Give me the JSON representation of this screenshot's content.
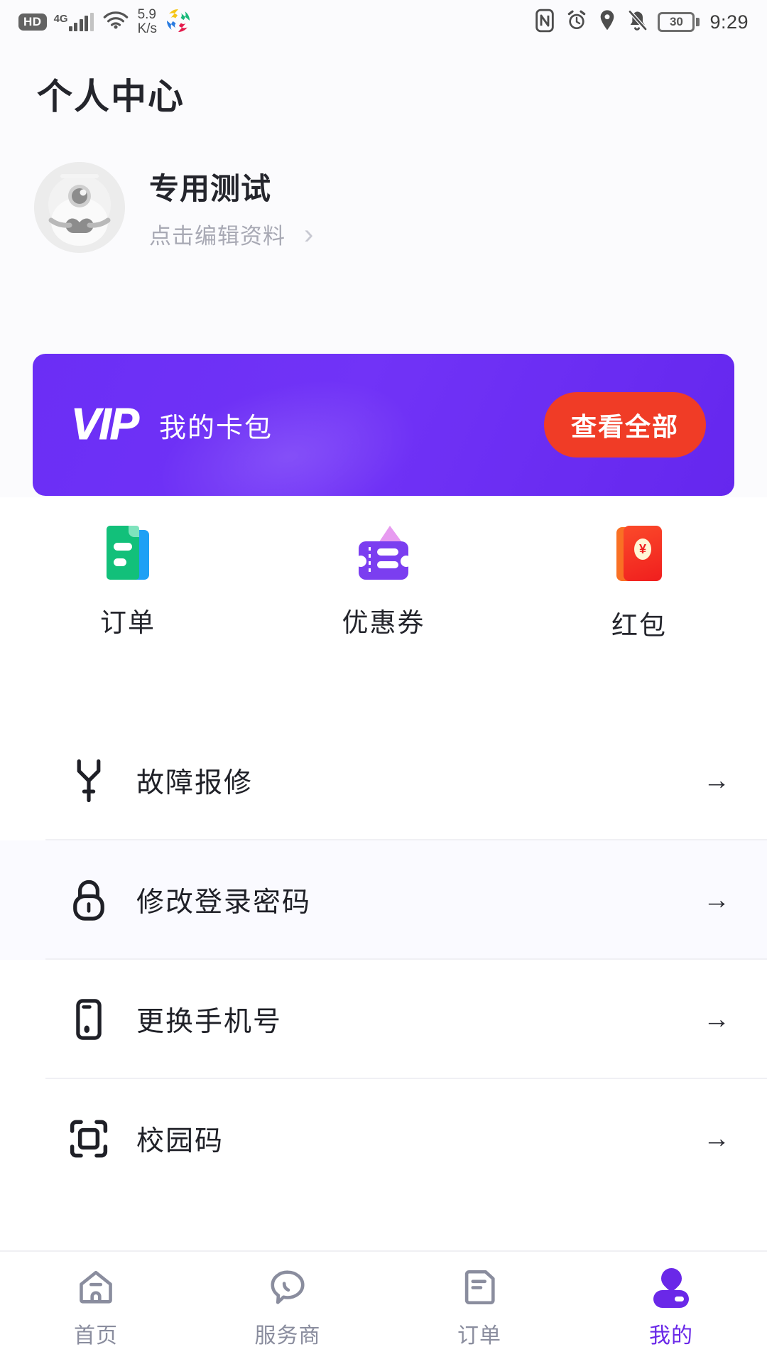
{
  "status_bar": {
    "hd_badge": "HD",
    "network": "4G",
    "net_speed": "5.9\nK/s",
    "net_speed_value": "5.9",
    "net_speed_unit": "K/s",
    "icons": [
      "hd-icon",
      "signal-icon",
      "wifi-icon",
      "app-logo-icon",
      "nfc-icon",
      "alarm-icon",
      "location-icon",
      "mute-icon",
      "battery-icon"
    ],
    "battery_level": "30",
    "time": "9:29"
  },
  "header": {
    "title": "个人中心"
  },
  "profile": {
    "name": "专用测试",
    "edit_label": "点击编辑资料",
    "chevron": "›"
  },
  "vip_banner": {
    "logo": "VIP",
    "label": "我的卡包",
    "button_label": "查看全部",
    "bg_color": "#6b2ef5",
    "button_color": "#f03c26"
  },
  "quick_actions": [
    {
      "label": "订单",
      "icon": "order-icon"
    },
    {
      "label": "优惠券",
      "icon": "coupon-icon"
    },
    {
      "label": "红包",
      "icon": "red-packet-icon"
    }
  ],
  "red_packet_symbol": "¥",
  "menu": {
    "arrow": "→",
    "items": [
      {
        "label": "故障报修",
        "icon": "wrench-icon"
      },
      {
        "label": "修改登录密码",
        "icon": "lock-icon"
      },
      {
        "label": "更换手机号",
        "icon": "phone-icon"
      },
      {
        "label": "校园码",
        "icon": "scan-code-icon"
      }
    ]
  },
  "tabbar": {
    "active_color": "#6a28e8",
    "inactive_color": "#8a8d9e",
    "items": [
      {
        "label": "首页",
        "icon": "home-icon",
        "active": false
      },
      {
        "label": "服务商",
        "icon": "chat-icon",
        "active": false
      },
      {
        "label": "订单",
        "icon": "order-doc-icon",
        "active": false
      },
      {
        "label": "我的",
        "icon": "person-icon",
        "active": true
      }
    ]
  }
}
